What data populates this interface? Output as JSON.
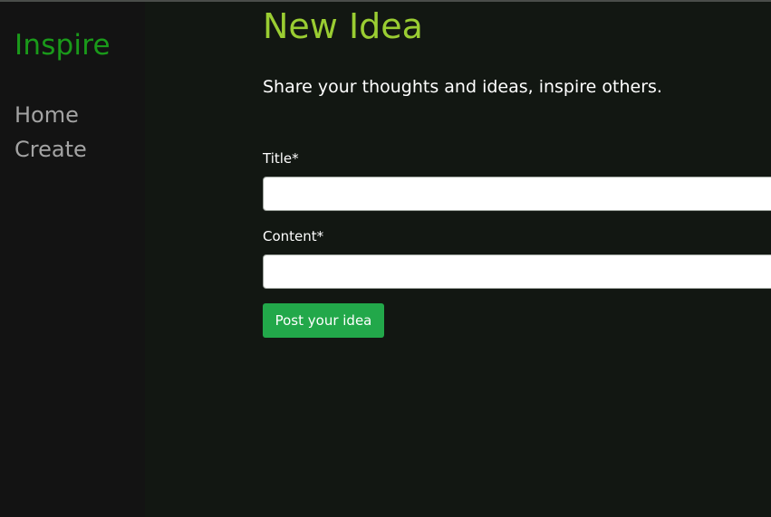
{
  "sidebar": {
    "brand": "Inspire",
    "nav": [
      {
        "label": "Home"
      },
      {
        "label": "Create"
      }
    ]
  },
  "main": {
    "title": "New Idea",
    "subtitle": "Share your thoughts and ideas, inspire others.",
    "form": {
      "title_label": "Title*",
      "title_value": "",
      "content_label": "Content*",
      "content_value": "",
      "submit_label": "Post your idea"
    }
  },
  "colors": {
    "brand": "#1a9a1a",
    "heading": "#9acd32",
    "button": "#22a84a",
    "sidebar_bg": "#131313",
    "main_bg": "#121712"
  }
}
